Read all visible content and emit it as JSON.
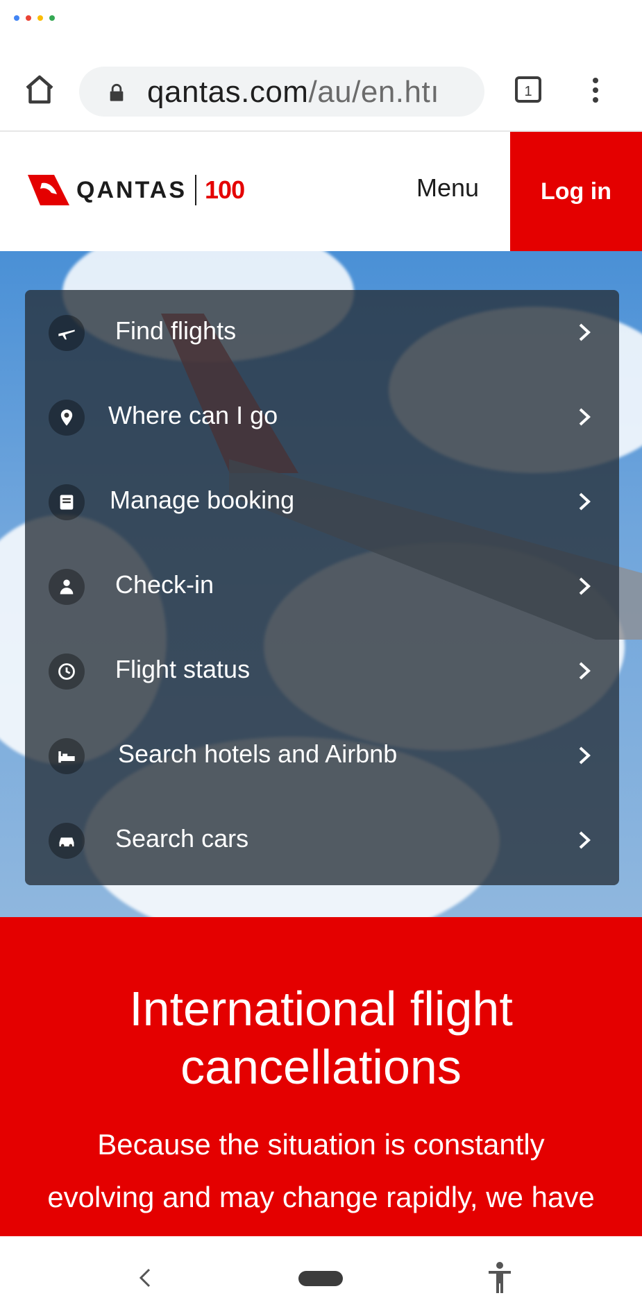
{
  "status_bar": {
    "dot_colors": [
      "#4285f4",
      "#ea4335",
      "#fbbc05",
      "#34a853"
    ]
  },
  "browser": {
    "home_icon": "home-icon",
    "lock_icon": "lock-icon",
    "url_host": "qantas.com",
    "url_path": "/au/en.htı",
    "tab_count": "1",
    "menu_icon": "more-vert-icon"
  },
  "header": {
    "logo_word": "QANTAS",
    "logo_badge": "100",
    "menu_label": "Menu",
    "login_label": "Log in",
    "brand_color": "#e40000"
  },
  "actions": [
    {
      "label": "Find flights",
      "icon": "plane-icon"
    },
    {
      "label": "Where can I go",
      "icon": "location-pin-icon"
    },
    {
      "label": "Manage booking",
      "icon": "booking-icon"
    },
    {
      "label": "Check-in",
      "icon": "person-icon"
    },
    {
      "label": "Flight status",
      "icon": "clock-icon"
    },
    {
      "label": "Search hotels and Airbnb",
      "icon": "bed-icon"
    },
    {
      "label": "Search cars",
      "icon": "car-icon"
    }
  ],
  "news": {
    "title": "International flight cancellations",
    "body": "Because the situation is constantly evolving and may change rapidly, we have not made a decision to cancel"
  },
  "nav": {
    "back_icon": "back-icon",
    "home_icon": "home-pill-icon",
    "accessibility_icon": "accessibility-icon"
  }
}
